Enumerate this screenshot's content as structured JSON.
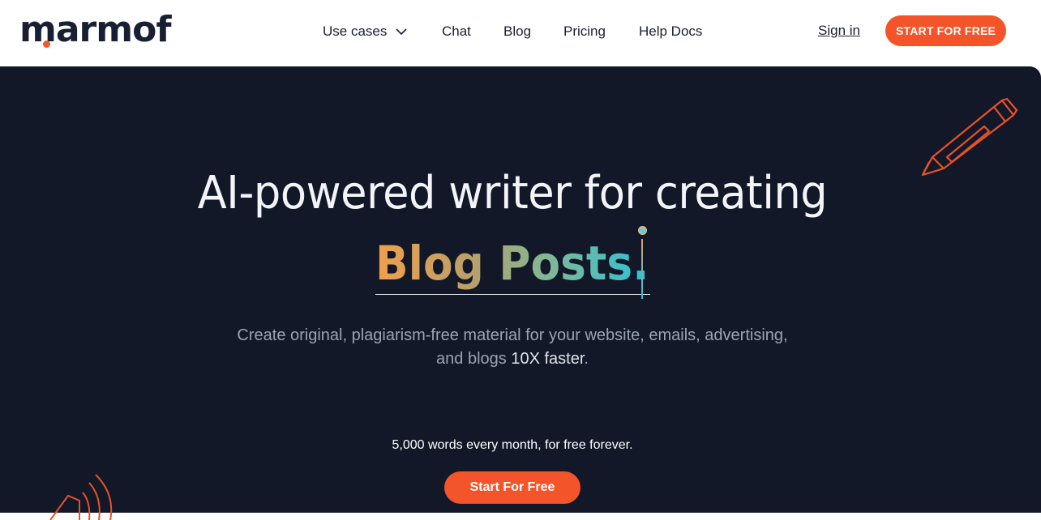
{
  "brand": {
    "logo_text": "marmof",
    "accent_color": "#f4542a",
    "hero_bg": "#121828"
  },
  "nav": {
    "use_cases": "Use cases",
    "chat": "Chat",
    "blog": "Blog",
    "pricing": "Pricing",
    "help_docs": "Help Docs",
    "sign_in": "Sign in",
    "start_for_free": "START FOR FREE"
  },
  "hero": {
    "headline": "AI-powered writer for creating",
    "typed_text": "Blog Posts.",
    "subtitle_part1": "Create original, plagiarism-free material for your website, emails, advertising, and blogs ",
    "subtitle_emphasis": "10X faster",
    "subtitle_end": ".",
    "free_words": "5,000 words every month, for free forever.",
    "cta_label": "Start For Free"
  },
  "icons": {
    "chevron": "chevron-down-icon",
    "pencil": "pencil-illustration-icon",
    "sound": "sound-waves-icon"
  }
}
